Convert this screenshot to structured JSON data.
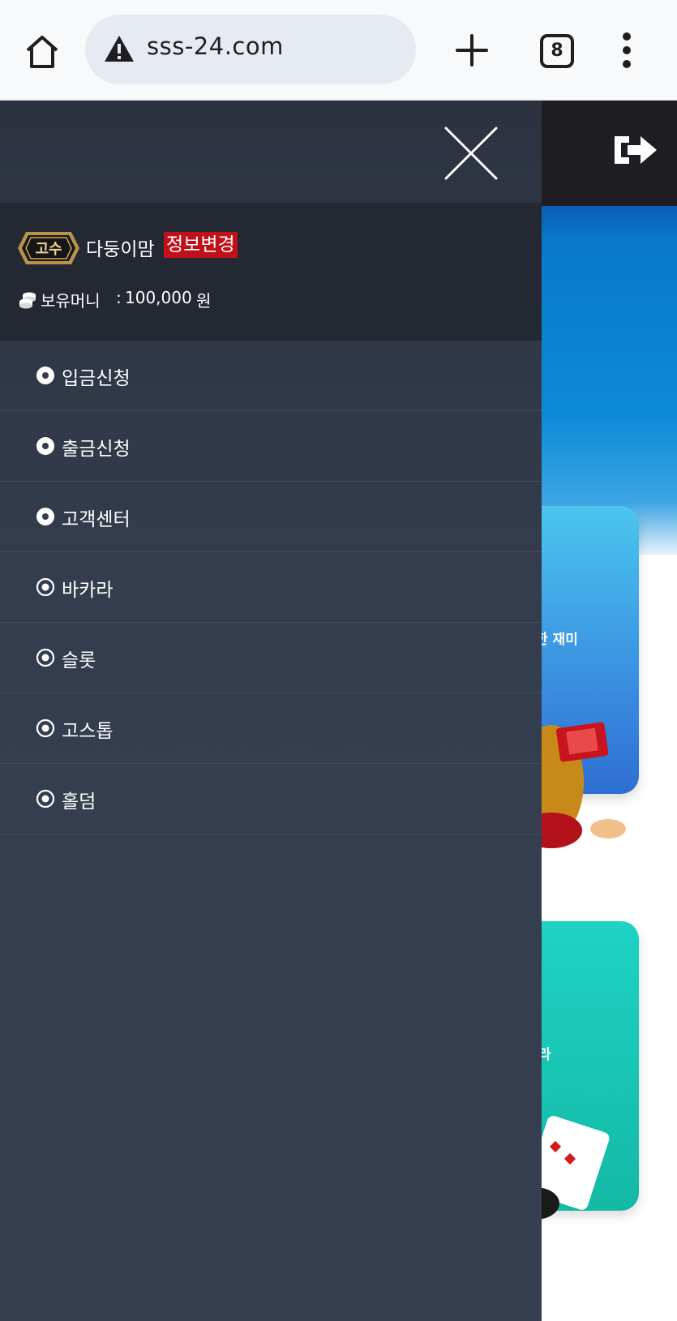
{
  "browser": {
    "url": "sss-24.com",
    "tab_count": "8"
  },
  "drawer": {
    "profile": {
      "rank_badge_text": "고수",
      "nickname": "다둥이맘",
      "edit_label": "정보변경",
      "balance_label": "보유머니",
      "balance_colon": ":",
      "balance_value": "100,000",
      "balance_unit": "원"
    },
    "menu": [
      {
        "label": "입금신청",
        "icon": "filled-circle-icon"
      },
      {
        "label": "출금신청",
        "icon": "filled-circle-icon"
      },
      {
        "label": "고객센터",
        "icon": "filled-circle-icon"
      },
      {
        "label": "바카라",
        "icon": "ring-dot-icon"
      },
      {
        "label": "슬롯",
        "icon": "ring-dot-icon"
      },
      {
        "label": "고스톱",
        "icon": "ring-dot-icon"
      },
      {
        "label": "홀덤",
        "icon": "ring-dot-icon"
      }
    ]
  },
  "background_page": {
    "card1_text": "한 재미",
    "card2_text": "라"
  },
  "colors": {
    "drawer_bg": "#343d4d",
    "profile_bg": "#232833",
    "edit_badge": "#c0101a",
    "banner_blue": "#0c8ad8",
    "card1": "#3a8fe0",
    "card2": "#13b9a5"
  }
}
